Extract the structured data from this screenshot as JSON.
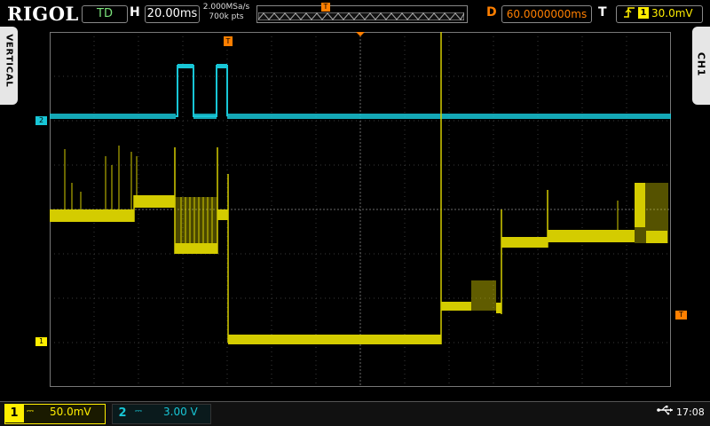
{
  "brand": "RIGOL",
  "run_state": "TD",
  "horizontal": {
    "label": "H",
    "timebase": "20.00ms",
    "sample_rate": "2.000MSa/s",
    "points": "700k pts"
  },
  "delay": {
    "label": "D",
    "value": "60.0000000ms"
  },
  "trigger": {
    "label": "T",
    "source": "1",
    "level": "30.0mV",
    "marker_glyph": "T"
  },
  "side_tabs": {
    "left": "VERTICAL",
    "right": "CH1"
  },
  "channels": [
    {
      "number": "1",
      "coupling": "⎓",
      "scale": "50.0mV",
      "color": "#ffee00"
    },
    {
      "number": "2",
      "coupling": "⎓",
      "scale": "3.00 V",
      "color": "#18c6d6"
    }
  ],
  "status": {
    "usb_icon": "usb-icon",
    "time": "17:08"
  }
}
